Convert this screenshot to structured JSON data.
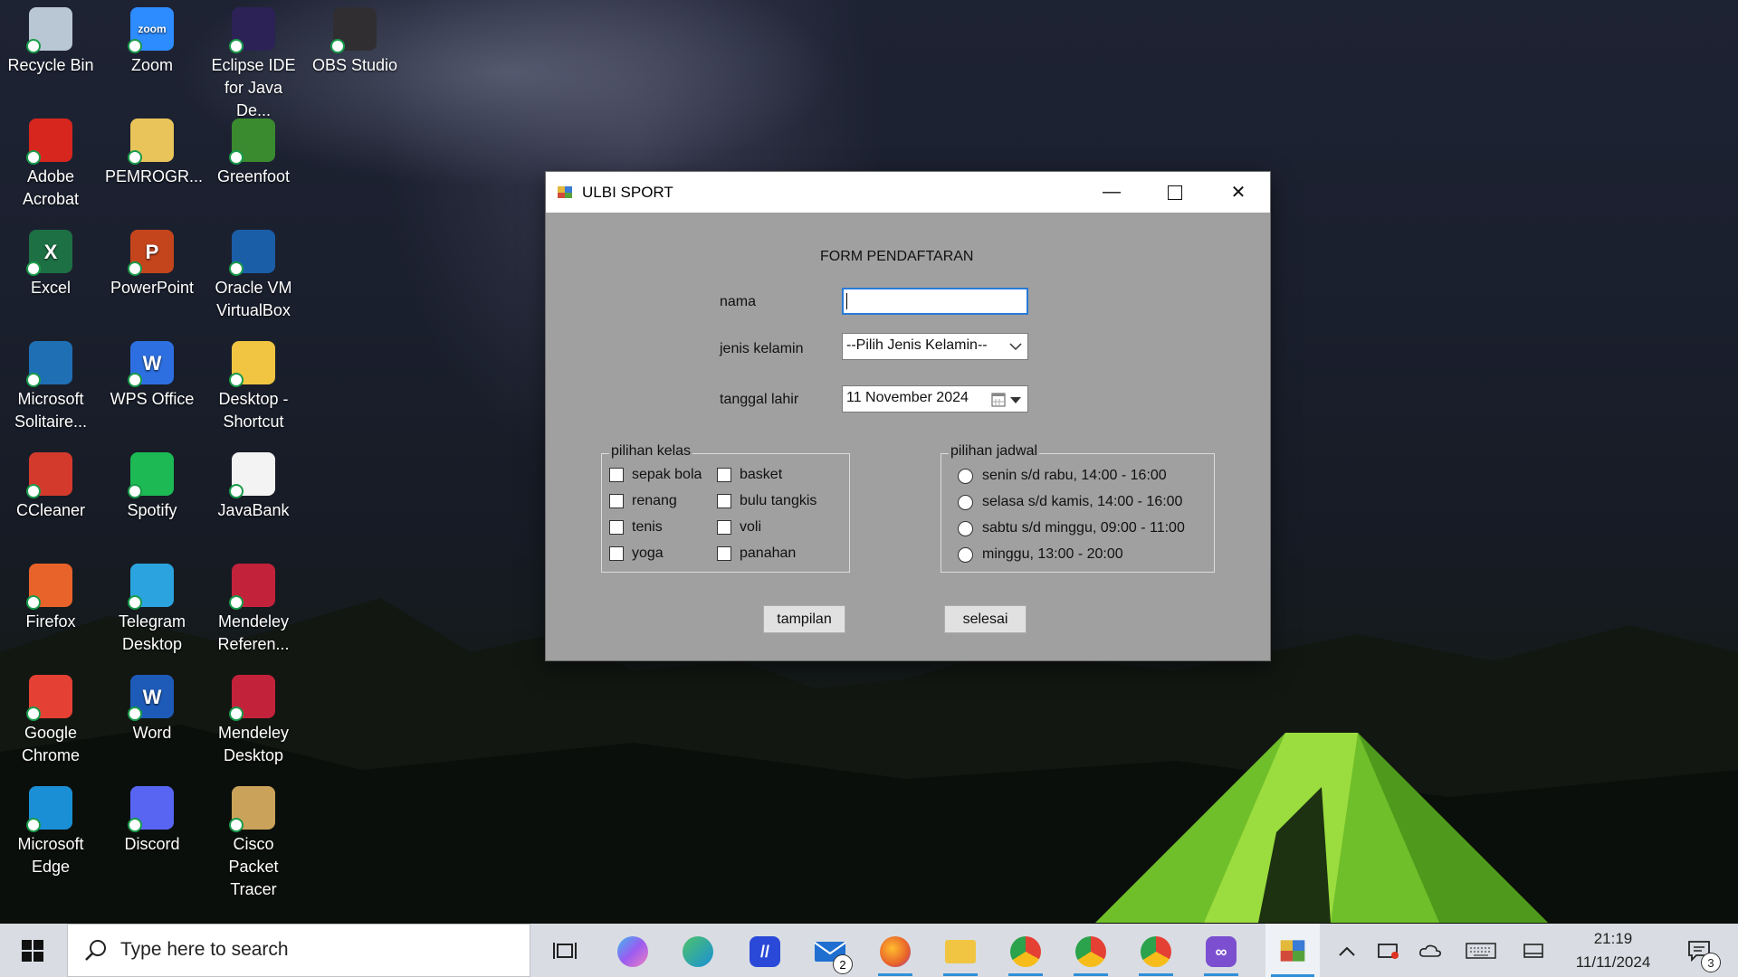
{
  "desktop_icons": [
    {
      "label_1": "Recycle Bin",
      "label_2": "",
      "icon": "recycle-bin-icon",
      "color": "#b9c6d3"
    },
    {
      "label_1": "Zoom",
      "label_2": "",
      "icon": "zoom-icon",
      "color": "#2d8cff",
      "text": "zoom"
    },
    {
      "label_1": "Eclipse IDE",
      "label_2": "for Java De...",
      "icon": "eclipse-icon",
      "color": "#2c2255"
    },
    {
      "label_1": "OBS Studio",
      "label_2": "",
      "icon": "obs-studio-icon",
      "color": "#302e31"
    },
    {
      "label_1": "Adobe",
      "label_2": "Acrobat",
      "icon": "adobe-acrobat-icon",
      "color": "#d7261e"
    },
    {
      "label_1": "PEMROGR...",
      "label_2": "",
      "icon": "folder-icon",
      "color": "#e9c45a"
    },
    {
      "label_1": "Greenfoot",
      "label_2": "",
      "icon": "greenfoot-icon",
      "color": "#3a8a2f"
    },
    {
      "label_1": "Excel",
      "label_2": "",
      "icon": "excel-icon",
      "color": "#1d7044",
      "text": "X"
    },
    {
      "label_1": "PowerPoint",
      "label_2": "",
      "icon": "powerpoint-icon",
      "color": "#c4451c",
      "text": "P"
    },
    {
      "label_1": "Oracle VM",
      "label_2": "VirtualBox",
      "icon": "virtualbox-icon",
      "color": "#1b5ea8"
    },
    {
      "label_1": "Microsoft",
      "label_2": "Solitaire...",
      "icon": "solitaire-icon",
      "color": "#1f6fb5"
    },
    {
      "label_1": "WPS Office",
      "label_2": "",
      "icon": "wps-office-icon",
      "color": "#2d6fe0",
      "text": "W"
    },
    {
      "label_1": "Desktop -",
      "label_2": "Shortcut",
      "icon": "desktop-shortcut-icon",
      "color": "#f1c542"
    },
    {
      "label_1": "CCleaner",
      "label_2": "",
      "icon": "ccleaner-icon",
      "color": "#d33a2c"
    },
    {
      "label_1": "Spotify",
      "label_2": "",
      "icon": "spotify-icon",
      "color": "#1db954"
    },
    {
      "label_1": "JavaBank",
      "label_2": "",
      "icon": "javabank-icon",
      "color": "#f3f3f3"
    },
    {
      "label_1": "Firefox",
      "label_2": "",
      "icon": "firefox-icon",
      "color": "#e8632a"
    },
    {
      "label_1": "Telegram",
      "label_2": "Desktop",
      "icon": "telegram-icon",
      "color": "#2aa3de"
    },
    {
      "label_1": "Mendeley",
      "label_2": "Referen...",
      "icon": "mendeley-reference-icon",
      "color": "#c3223b"
    },
    {
      "label_1": "Google",
      "label_2": "Chrome",
      "icon": "google-chrome-icon",
      "color": "#e44134"
    },
    {
      "label_1": "Word",
      "label_2": "",
      "icon": "word-icon",
      "color": "#1e5bb8",
      "text": "W"
    },
    {
      "label_1": "Mendeley",
      "label_2": "Desktop",
      "icon": "mendeley-desktop-icon",
      "color": "#c3223b"
    },
    {
      "label_1": "Microsoft",
      "label_2": "Edge",
      "icon": "microsoft-edge-icon",
      "color": "#1a8fd6"
    },
    {
      "label_1": "Discord",
      "label_2": "",
      "icon": "discord-icon",
      "color": "#5865f2"
    },
    {
      "label_1": "Cisco Packet",
      "label_2": "Tracer",
      "icon": "cisco-packet-tracer-icon",
      "color": "#caa25a"
    }
  ],
  "window": {
    "title": "ULBI SPORT",
    "form_title": "FORM PENDAFTARAN",
    "nama_label": "nama",
    "nama_value": "",
    "jenis_kelamin_label": "jenis kelamin",
    "jenis_kelamin_value": "--Pilih Jenis Kelamin--",
    "tanggal_lahir_label": "tanggal lahir",
    "tanggal_lahir_value": "11 November 2024",
    "kelas_group_title": "pilihan kelas",
    "kelas_options": [
      "sepak bola",
      "renang",
      "tenis",
      "yoga",
      "basket",
      "bulu tangkis",
      "voli",
      "panahan"
    ],
    "jadwal_group_title": "pilihan jadwal",
    "jadwal_options": [
      "senin s/d rabu, 14:00 - 16:00",
      "selasa s/d kamis, 14:00 - 16:00",
      "sabtu s/d minggu, 09:00 - 11:00",
      "minggu, 13:00 - 20:00"
    ],
    "button_tampilan": "tampilan",
    "button_selesai": "selesai"
  },
  "taskbar": {
    "search_placeholder": "Type here to search",
    "mail_badge": "2",
    "clock_time": "21:19",
    "clock_date": "11/11/2024",
    "notification_count": "3"
  }
}
